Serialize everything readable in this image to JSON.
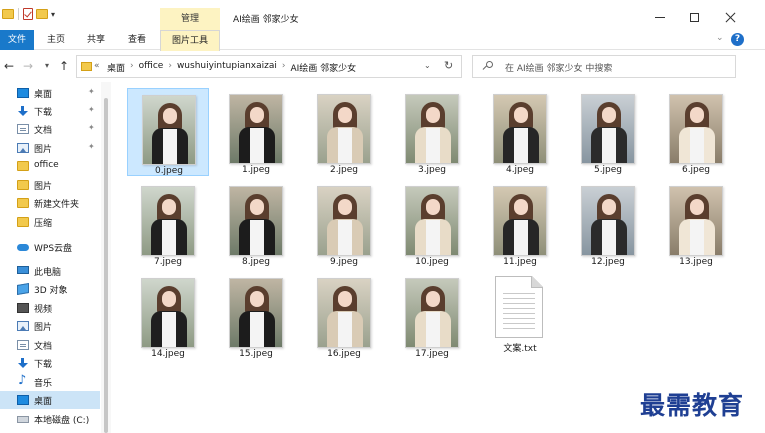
{
  "window": {
    "title": "AI绘画  邻家少女",
    "context_tab": "管理"
  },
  "ribbon": {
    "tabs": [
      "文件",
      "主页",
      "共享",
      "查看",
      "图片工具"
    ],
    "active_tab": "文件",
    "help": "?"
  },
  "address": {
    "prefix": "«",
    "breadcrumbs": [
      "桌面",
      "office",
      "wushuiyintupianxaizai",
      "AI绘画  邻家少女"
    ],
    "separator": "›"
  },
  "search": {
    "placeholder": "在 AI绘画  邻家少女 中搜索"
  },
  "sidebar": {
    "items": [
      {
        "label": "桌面",
        "icon": "desktop-icon",
        "pinned": true
      },
      {
        "label": "下载",
        "icon": "download-icon",
        "pinned": true
      },
      {
        "label": "文档",
        "icon": "document-icon",
        "pinned": true
      },
      {
        "label": "图片",
        "icon": "pictures-icon",
        "pinned": true
      },
      {
        "label": "office",
        "icon": "folder-icon",
        "pinned": false
      },
      {
        "label": "图片",
        "icon": "folder-icon",
        "pinned": false
      },
      {
        "label": "新建文件夹",
        "icon": "folder-icon",
        "pinned": false
      },
      {
        "label": "压缩",
        "icon": "folder-icon",
        "pinned": false
      },
      {
        "label": "WPS云盘",
        "icon": "cloud-icon",
        "pinned": false
      },
      {
        "label": "此电脑",
        "icon": "computer-icon",
        "pinned": false
      },
      {
        "label": "3D 对象",
        "icon": "3d-objects-icon",
        "pinned": false
      },
      {
        "label": "视频",
        "icon": "video-icon",
        "pinned": false
      },
      {
        "label": "图片",
        "icon": "pictures-icon",
        "pinned": false
      },
      {
        "label": "文档",
        "icon": "document-icon",
        "pinned": false
      },
      {
        "label": "下载",
        "icon": "download-icon",
        "pinned": false
      },
      {
        "label": "音乐",
        "icon": "music-icon",
        "pinned": false
      },
      {
        "label": "桌面",
        "icon": "desktop-icon",
        "pinned": false,
        "selected": true
      },
      {
        "label": "本地磁盘 (C:)",
        "icon": "drive-icon",
        "pinned": false
      }
    ]
  },
  "files": [
    {
      "name": "0.jpeg",
      "selected": true
    },
    {
      "name": "1.jpeg"
    },
    {
      "name": "2.jpeg"
    },
    {
      "name": "3.jpeg"
    },
    {
      "name": "4.jpeg"
    },
    {
      "name": "5.jpeg"
    },
    {
      "name": "6.jpeg"
    },
    {
      "name": "7.jpeg"
    },
    {
      "name": "8.jpeg"
    },
    {
      "name": "9.jpeg"
    },
    {
      "name": "10.jpeg"
    },
    {
      "name": "11.jpeg"
    },
    {
      "name": "12.jpeg"
    },
    {
      "name": "13.jpeg"
    },
    {
      "name": "14.jpeg"
    },
    {
      "name": "15.jpeg"
    },
    {
      "name": "16.jpeg"
    },
    {
      "name": "17.jpeg"
    },
    {
      "name": "文案.txt",
      "type": "text"
    }
  ],
  "watermark": "最需教育",
  "colors": {
    "accent": "#1979ca",
    "selection": "#cce8ff",
    "context_tab": "#fdf3c2",
    "watermark": "#1f3f93"
  }
}
